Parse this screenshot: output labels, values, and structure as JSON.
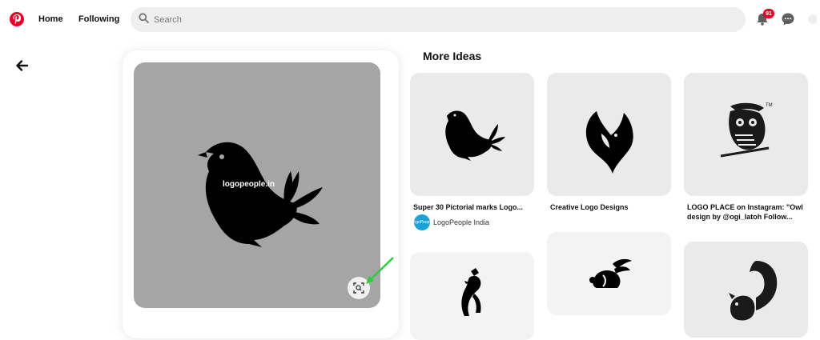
{
  "header": {
    "nav": {
      "home": "Home",
      "following": "Following"
    },
    "search": {
      "placeholder": "Search",
      "value": ""
    },
    "notifications_count": "91"
  },
  "pin": {
    "watermark": "logopeople.in"
  },
  "more_ideas": {
    "title": "More Ideas",
    "items": [
      {
        "title": "Super 30 Pictorial marks Logo...",
        "author": "LogoPeople India",
        "author_avatar_text": "LogoPeople"
      },
      {
        "title": "Creative Logo Designs"
      },
      {
        "title": "LOGO PLACE on Instagram: \"Owl design by @ogi_latoh Follow..."
      }
    ]
  },
  "colors": {
    "brand": "#e60023",
    "image_bg": "#a5a5a5",
    "tile_bg": "#eaeaea",
    "annotation_arrow": "#2ecc40"
  },
  "icons": [
    "pinterest-logo-icon",
    "search-icon",
    "bell-icon",
    "chat-icon",
    "back-arrow-icon",
    "visual-search-icon"
  ]
}
